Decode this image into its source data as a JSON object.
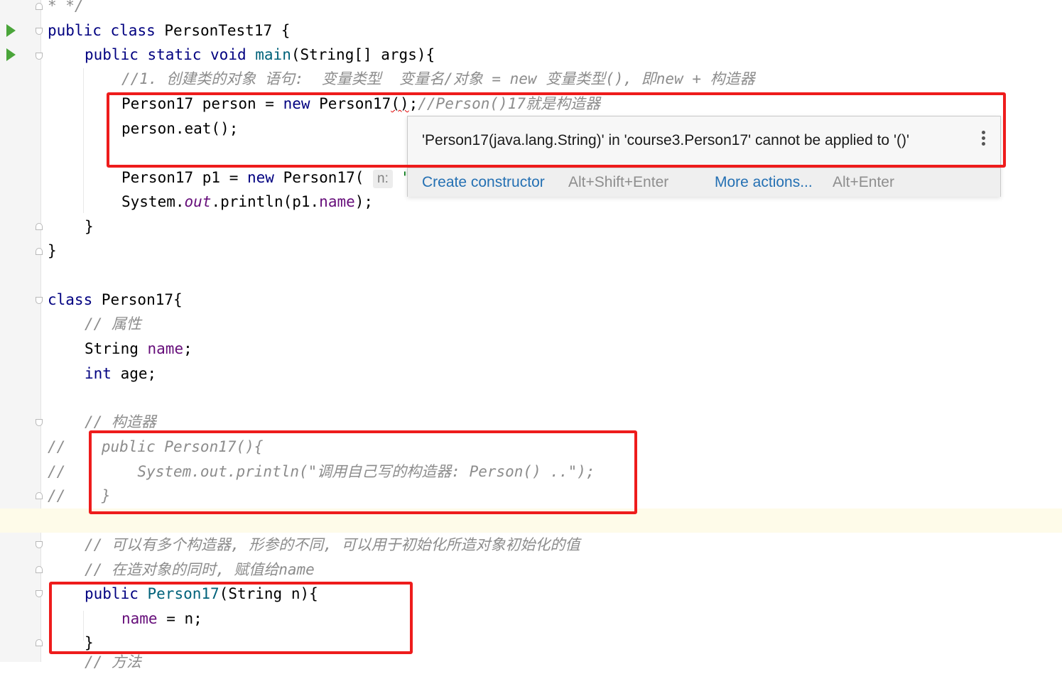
{
  "editor": {
    "lines": {
      "l0": "* */",
      "l1": {
        "kw1": "public",
        "kw2": "class",
        "name": "PersonTest17",
        "brace": "{"
      },
      "l2": {
        "kw1": "public",
        "kw2": "static",
        "kw3": "void",
        "method": "main",
        "params": "(String[] args){"
      },
      "l3": "//1. 创建类的对象 语句:  变量类型  变量名/对象 = new 变量类型(), 即new + 构造器",
      "l4": {
        "p1": "Person17 person = ",
        "kw": "new",
        "p2": " Person17",
        "err": "()",
        "semi": ";",
        "comment": "//Person()17就是构造器"
      },
      "l5": "person.eat();",
      "l7": {
        "p1": "Person17 p1 = ",
        "kw": "new",
        "p2": " Person17( ",
        "hint": "n:",
        "p3": " \""
      },
      "l8": {
        "p1": "System.",
        "out": "out",
        "p2": ".println(p1.",
        "field": "name",
        "p3": ");"
      },
      "l9": "}",
      "l10": "}",
      "l12": {
        "kw": "class",
        "rest": " Person17{"
      },
      "l13": "// 属性",
      "l14": {
        "type": "String ",
        "field": "name",
        "semi": ";"
      },
      "l15": {
        "kw": "int",
        "rest": " age;"
      },
      "l17": "// 构造器",
      "l18": "//    public Person17(){",
      "l19": "//        System.out.println(\"调用自己写的构造器: Person() ..\");",
      "l20": "//    }",
      "l22": "// 可以有多个构造器, 形参的不同, 可以用于初始化所造对象初始化的值",
      "l23": "// 在造对象的同时, 赋值给name",
      "l24": {
        "kw": "public",
        "ctor": "Person17",
        "rest": "(String n){"
      },
      "l25": {
        "field": "name",
        "rest": " = n;"
      },
      "l26": "}",
      "l27": "// 方法"
    }
  },
  "tooltip": {
    "message": "'Person17(java.lang.String)' in 'course3.Person17' cannot be applied to '()'",
    "action1_label": "Create constructor",
    "action1_key": "Alt+Shift+Enter",
    "action2_label": "More actions...",
    "action2_key": "Alt+Enter",
    "more_icon": "vertical-ellipsis-icon"
  },
  "colors": {
    "keyword": "#000080",
    "field": "#660e7a",
    "comment": "#8c8c8c",
    "link": "#2470b3",
    "highlight_box": "#ee1c1c",
    "run_icon": "#4aa53a"
  }
}
